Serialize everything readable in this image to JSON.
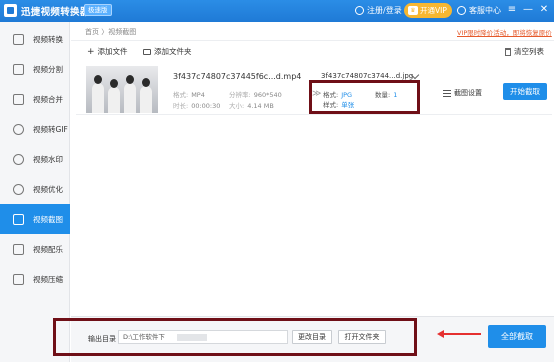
{
  "app": {
    "title": "迅捷视频转换器",
    "badge": "极速版",
    "user": "注册/登录",
    "vip": "开通VIP",
    "service": "客服中心",
    "controls": [
      "≡",
      "—",
      "✕"
    ]
  },
  "sidebar": {
    "items": [
      {
        "label": "视频转换",
        "icon": "convert-icon"
      },
      {
        "label": "视频分割",
        "icon": "split-icon"
      },
      {
        "label": "视频合并",
        "icon": "merge-icon"
      },
      {
        "label": "视频转GIF",
        "icon": "gif-icon"
      },
      {
        "label": "视频水印",
        "icon": "watermark-icon"
      },
      {
        "label": "视频优化",
        "icon": "optimize-icon"
      },
      {
        "label": "视频截图",
        "icon": "screenshot-icon",
        "active": true
      },
      {
        "label": "视频配乐",
        "icon": "music-icon"
      },
      {
        "label": "视频压缩",
        "icon": "compress-icon"
      }
    ]
  },
  "breadcrumb": "首页 〉视频截图",
  "promo": "VIP限时降价活动，即将恢复原价",
  "toolbar": {
    "add_file": "添加文件",
    "add_folder": "添加文件夹",
    "clear": "清空列表"
  },
  "file": {
    "name": "3f437c74807c37445f6c...d.mp4",
    "format_label": "格式:",
    "format": "MP4",
    "resolution_label": "分辨率:",
    "resolution": "960*540",
    "duration_label": "时长:",
    "duration": "00:00:30",
    "size_label": "大小:",
    "size": "4.14 MB",
    "output_name": "3f437c74807c3744...d.jpg",
    "cfg_format_label": "格式:",
    "cfg_format": "JPG",
    "cfg_count_label": "数量:",
    "cfg_count": "1",
    "cfg_style_label": "样式:",
    "cfg_style": "单张",
    "settings": "截图设置",
    "start": "开始截取"
  },
  "bottom": {
    "output_label": "输出目录",
    "output_path": "D:\\工作软件下",
    "change_dir": "更改目录",
    "open_folder": "打开文件夹",
    "all_capture": "全部截取"
  }
}
